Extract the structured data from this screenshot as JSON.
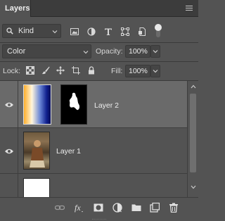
{
  "panel": {
    "tab_label": "Layers"
  },
  "filter": {
    "kind_label": "Kind"
  },
  "blend": {
    "mode": "Color",
    "opacity_label": "Opacity:",
    "opacity_value": "100%"
  },
  "lock": {
    "lock_label": "Lock:",
    "fill_label": "Fill:",
    "fill_value": "100%"
  },
  "layers": [
    {
      "name": "Layer 2",
      "selected": true,
      "visible": true,
      "has_mask": true
    },
    {
      "name": "Layer 1",
      "selected": false,
      "visible": true,
      "has_mask": false
    },
    {
      "name": "",
      "selected": false,
      "visible": false,
      "has_mask": false
    }
  ],
  "footer": {
    "icons": [
      "link-icon",
      "fx-icon",
      "mask-icon",
      "adjustment-icon",
      "group-folder-icon",
      "new-layer-icon",
      "trash-icon"
    ]
  }
}
